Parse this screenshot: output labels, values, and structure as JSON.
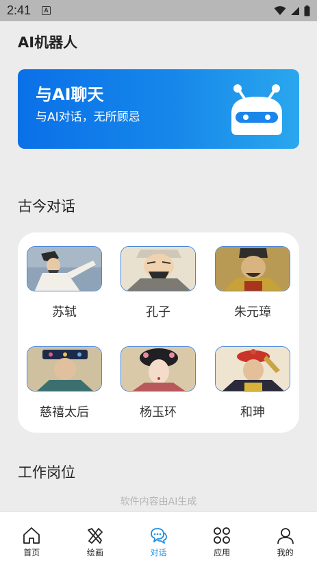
{
  "status": {
    "time": "2:41",
    "badge": "A"
  },
  "app": {
    "title": "AI机器人"
  },
  "hero": {
    "title": "与AI聊天",
    "subtitle": "与AI对话，无所顾忌"
  },
  "sections": {
    "ancient": "古今对话",
    "jobs": "工作岗位"
  },
  "people": [
    {
      "name": "苏轼"
    },
    {
      "name": "孔子"
    },
    {
      "name": "朱元璋"
    },
    {
      "name": "慈禧太后"
    },
    {
      "name": "杨玉环"
    },
    {
      "name": "和珅"
    }
  ],
  "footer_note": "软件内容由AI生成",
  "tabs": [
    {
      "label": "首页",
      "icon": "home-icon"
    },
    {
      "label": "绘画",
      "icon": "brush-icon"
    },
    {
      "label": "对话",
      "icon": "chat-icon",
      "active": true
    },
    {
      "label": "应用",
      "icon": "apps-icon"
    },
    {
      "label": "我的",
      "icon": "profile-icon"
    }
  ],
  "colors": {
    "accent": "#1b8ee0",
    "hero_start": "#0a70e8",
    "hero_end": "#2aa7ee"
  }
}
